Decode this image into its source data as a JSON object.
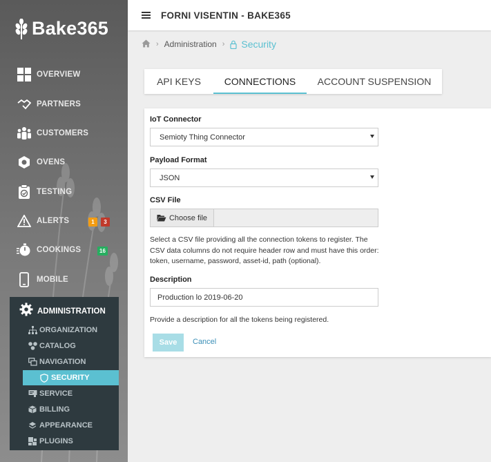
{
  "app": {
    "title": "FORNI VISENTIN - BAKE365",
    "logo_text": "Bake365"
  },
  "sidebar": {
    "items": [
      {
        "label": "OVERVIEW",
        "icon": "grid-icon"
      },
      {
        "label": "PARTNERS",
        "icon": "handshake-icon"
      },
      {
        "label": "CUSTOMERS",
        "icon": "users-icon"
      },
      {
        "label": "OVENS",
        "icon": "hexagon-icon"
      },
      {
        "label": "TESTING",
        "icon": "clipboard-check-icon"
      },
      {
        "label": "ALERTS",
        "icon": "warning-icon"
      },
      {
        "label": "COOKINGS",
        "icon": "timer-icon"
      },
      {
        "label": "MOBILE",
        "icon": "mobile-icon"
      }
    ],
    "alerts_badges": [
      {
        "value": "1",
        "color": "#f39c12"
      },
      {
        "value": "3",
        "color": "#c0392b"
      }
    ],
    "cookings_badge": {
      "value": "16",
      "color": "#27ae60"
    },
    "admin": {
      "label": "ADMINISTRATION",
      "icon": "gear-icon",
      "items": [
        {
          "label": "ORGANIZATION",
          "icon": "sitemap-icon"
        },
        {
          "label": "CATALOG",
          "icon": "cubes-icon"
        },
        {
          "label": "NAVIGATION",
          "icon": "windows-icon"
        },
        {
          "label": "SECURITY",
          "icon": "shield-icon",
          "active": true
        },
        {
          "label": "SERVICE",
          "icon": "server-icon"
        },
        {
          "label": "BILLING",
          "icon": "box-icon"
        },
        {
          "label": "APPEARANCE",
          "icon": "layers-icon"
        },
        {
          "label": "PLUGINS",
          "icon": "puzzle-icon"
        }
      ]
    }
  },
  "breadcrumb": {
    "home_icon": "home-icon",
    "parent": "Administration",
    "current": "Security"
  },
  "tabs": [
    {
      "label": "API KEYS"
    },
    {
      "label": "CONNECTIONS",
      "active": true
    },
    {
      "label": "ACCOUNT SUSPENSION"
    }
  ],
  "form": {
    "iot_label": "IoT Connector",
    "iot_value": "Semioty Thing Connector",
    "payload_label": "Payload Format",
    "payload_value": "JSON",
    "csv_label": "CSV File",
    "choose_file_label": "Choose file",
    "csv_help": "Select a CSV file providing all the connection tokens to register. The CSV data columns do not require header row and must have this order: token, username, password, asset-id, path (optional).",
    "description_label": "Description",
    "description_value": "Production lo 2019-06-20",
    "description_help": "Provide a description for all the tokens being registered.",
    "save_label": "Save",
    "cancel_label": "Cancel"
  },
  "colors": {
    "accent": "#5bc0d1",
    "admin_bg": "#2e3a3f",
    "save_disabled": "#a8dde6"
  }
}
